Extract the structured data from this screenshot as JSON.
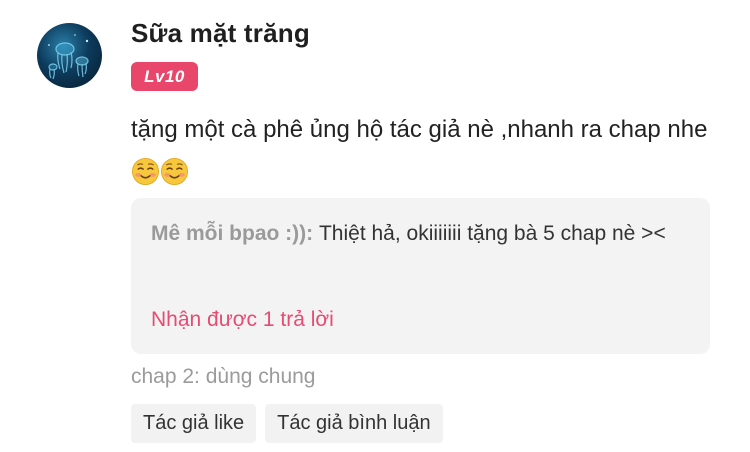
{
  "comment": {
    "author": "Sữa mặt trăng",
    "level": "Lv10",
    "text": "tặng một cà phê ủng hộ tác giả nè ,nhanh ra chap nhe",
    "emojis": [
      "smiling-face-icon",
      "smiling-face-icon"
    ],
    "reply": {
      "author": "Mê mỗi bpao :))",
      "separator": ": ",
      "text": "Thiệt hả, okiiiiiii tặng bà 5 chap nè ><",
      "link": "Nhận được 1 trả lời"
    },
    "chapter": "chap 2: dùng chung",
    "tags": [
      "Tác giả like",
      "Tác giả bình luận"
    ]
  },
  "colors": {
    "badge": "#e8466b",
    "link": "#e64b73",
    "muted": "#9b9b9b",
    "reply_bg": "#f3f3f3",
    "tag_bg": "#f2f2f2"
  }
}
